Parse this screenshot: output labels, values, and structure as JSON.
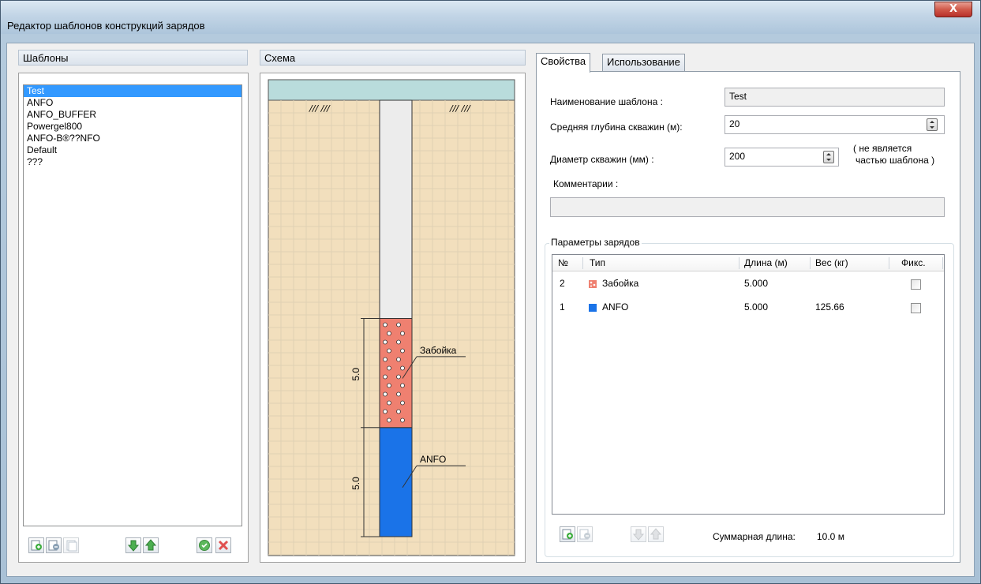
{
  "window": {
    "title": "Редактор шаблонов конструкций зарядов",
    "close_label": "X"
  },
  "templates": {
    "header": "Шаблоны",
    "items": [
      "Test",
      "ANFO",
      "ANFO_BUFFER",
      "Powergel800",
      "ANFO-B®??NFO",
      "Default",
      "???"
    ],
    "selected_index": 0
  },
  "schema": {
    "header": "Схема",
    "surface_marks": [
      "/// ///",
      "/// ///"
    ],
    "charges": [
      {
        "label": "Забойка",
        "length": "5.0",
        "color": "#ef8070",
        "pattern": "dots"
      },
      {
        "label": "ANFO",
        "length": "5.0",
        "color": "#1a73e8",
        "pattern": "solid"
      }
    ]
  },
  "tabs": [
    {
      "label": "Свойства",
      "active": true
    },
    {
      "label": "Использование",
      "active": false
    }
  ],
  "properties": {
    "name_label": "Наименование шаблона :",
    "name_value": "Test",
    "depth_label": "Средняя глубина скважин (м):",
    "depth_value": "20",
    "diameter_label": "Диаметр скважин (мм) :",
    "diameter_value": "200",
    "diameter_note_line1": "( не является",
    "diameter_note_line2": "частью шаблона )",
    "comments_label": "Комментарии :",
    "comments_value": ""
  },
  "charges_table": {
    "group_title": "Параметры зарядов",
    "columns": [
      "№",
      "Тип",
      "Длина (м)",
      "Вес (кг)",
      "Фикс."
    ],
    "rows": [
      {
        "num": "2",
        "type": "Забойка",
        "length": "5.000",
        "weight": "",
        "fixed": false,
        "icon_color": "#ef8070"
      },
      {
        "num": "1",
        "type": "ANFO",
        "length": "5.000",
        "weight": "125.66",
        "fixed": false,
        "icon_color": "#1a73e8"
      }
    ],
    "total_label": "Суммарная длина:",
    "total_value": "10.0 м"
  },
  "colors": {
    "sky": "#b9dcdc",
    "ground": "#f2dfbd",
    "selection": "#3399ff"
  }
}
